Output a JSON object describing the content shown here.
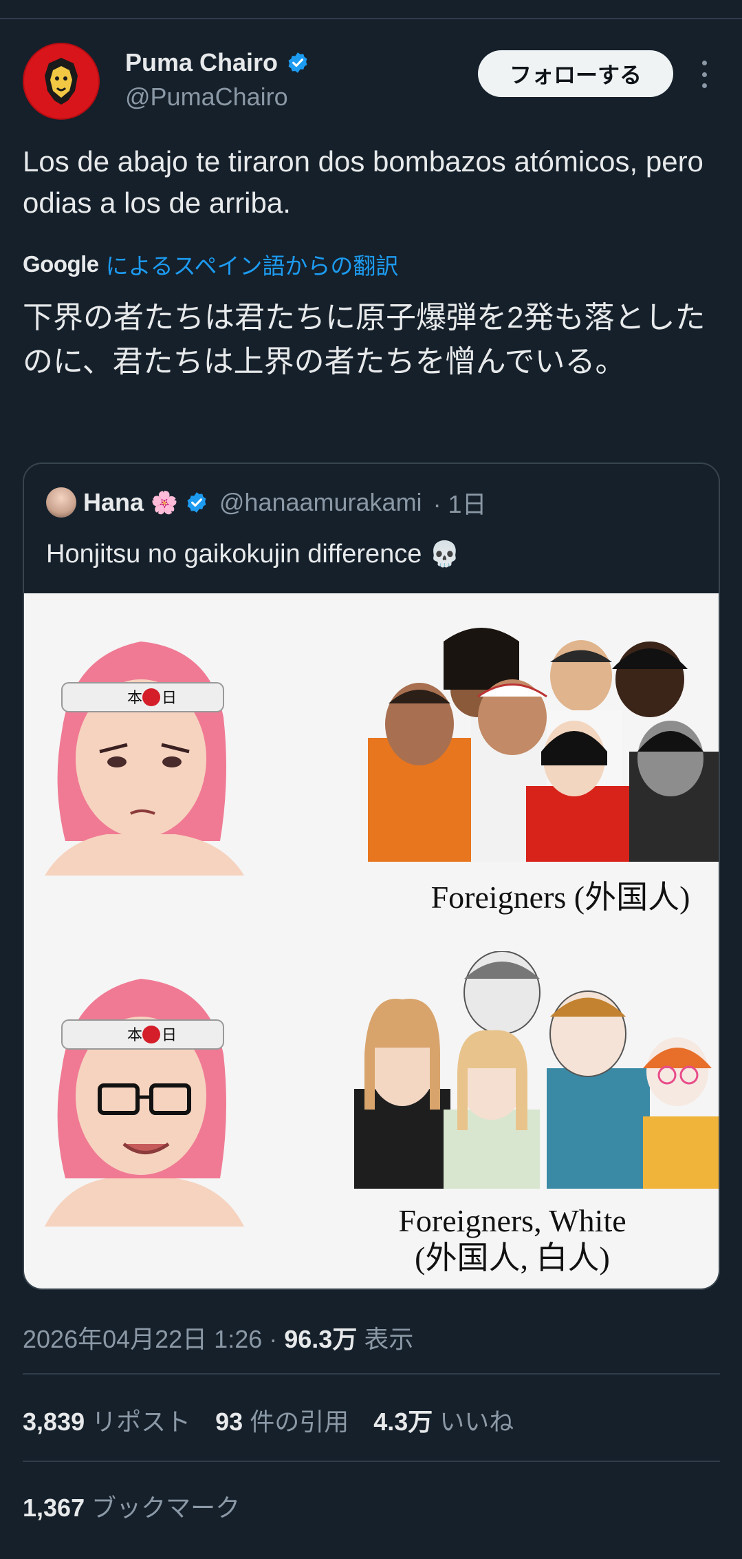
{
  "author": {
    "name": "Puma Chairo",
    "handle": "@PumaChairo",
    "verified": true
  },
  "follow_label": "フォローする",
  "tweet": {
    "text": "Los de abajo te tiraron dos bombazos atómicos, pero odias a los de arriba.",
    "translation_provider": "Google",
    "translation_label": "によるスペイン語からの翻訳",
    "translated_text": "下界の者たちは君たちに原子爆弾を2発も落としたのに、君たちは上界の者たちを憎んでいる。"
  },
  "quote": {
    "name": "Hana",
    "name_emoji": "🌸",
    "handle": "@hanaamurakami",
    "age": "· 1日",
    "text": "Honjitsu no gaikokujin difference",
    "text_emoji": "💀",
    "meme": {
      "headband_text_left": "本",
      "headband_text_right": "日",
      "caption_top": "Foreigners (外国人)",
      "caption_bottom_line1": "Foreigners, White",
      "caption_bottom_line2": "(外国人, 白人)"
    }
  },
  "meta": {
    "datetime": "2026年04月22日 1:26 ·",
    "views": "96.3万",
    "views_label": "表示"
  },
  "stats": {
    "reposts": "3,839",
    "reposts_label": "リポスト",
    "quotes": "93",
    "quotes_label": "件の引用",
    "likes": "4.3万",
    "likes_label": "いいね",
    "bookmarks": "1,367",
    "bookmarks_label": "ブックマーク"
  },
  "colors": {
    "background": "#15202b",
    "accent_blue": "#1d9bf0",
    "secondary_text": "#8b98a5",
    "avatar_red": "#e8141b"
  }
}
